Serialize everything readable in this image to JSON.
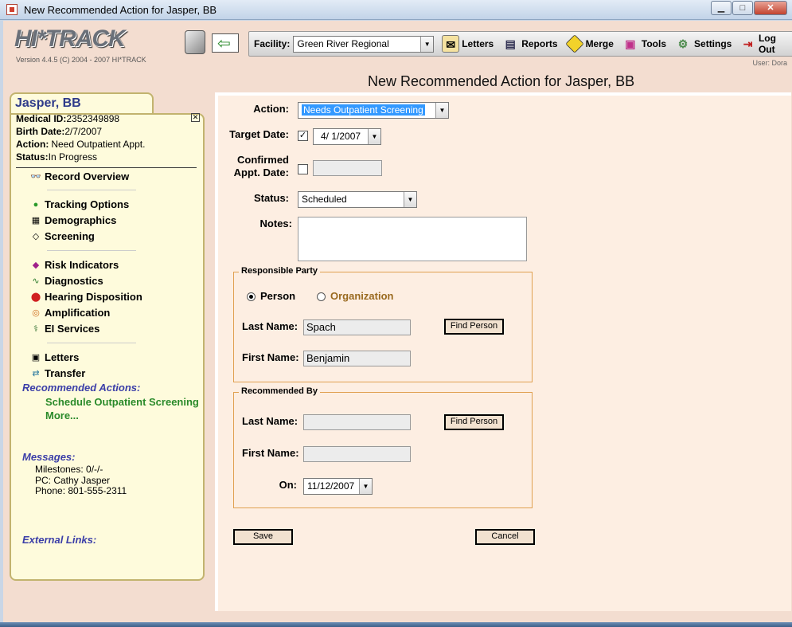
{
  "window": {
    "title": "New Recommended Action for Jasper, BB"
  },
  "header": {
    "logo": "HI*TRACK",
    "version": "Version 4.4.5 (C) 2004 - 2007 HI*TRACK",
    "facility_label": "Facility:",
    "facility_value": "Green River Regional",
    "toolbar": [
      "Letters",
      "Reports",
      "Merge",
      "Tools",
      "Settings",
      "Log Out"
    ],
    "user": "User: Dora",
    "page_heading": "New Recommended Action for Jasper, BB"
  },
  "patient": {
    "name": "Jasper, BB",
    "medical_id_label": "Medical ID:",
    "medical_id": "2352349898",
    "birth_label": "Birth Date:",
    "birth_date": "2/7/2007",
    "action_label": "Action:",
    "action": "Need Outpatient Appt.",
    "status_label": "Status:",
    "status": "In Progress"
  },
  "nav": {
    "record_overview": "Record Overview",
    "tracking_options": "Tracking Options",
    "demographics": "Demographics",
    "screening": "Screening",
    "risk_indicators": "Risk Indicators",
    "diagnostics": "Diagnostics",
    "hearing_disposition": "Hearing Disposition",
    "amplification": "Amplification",
    "ei_services": "EI Services",
    "letters": "Letters",
    "transfer": "Transfer"
  },
  "recommended": {
    "heading": "Recommended Actions:",
    "link": "Schedule Outpatient Screening",
    "more": "More..."
  },
  "messages": {
    "heading": "Messages:",
    "milestones": "Milestones: 0/-/-",
    "pc": "PC: Cathy Jasper",
    "phone": "Phone: 801-555-2311"
  },
  "external_links": "External Links:",
  "form": {
    "action_label": "Action:",
    "action_value": "Needs Outpatient Screening",
    "target_date_label": "Target Date:",
    "target_date_checked": true,
    "target_date_value": "4/  1/2007",
    "confirmed_label_1": "Confirmed",
    "confirmed_label_2": "Appt. Date:",
    "confirmed_checked": false,
    "confirmed_value": "",
    "status_label": "Status:",
    "status_value": "Scheduled",
    "notes_label": "Notes:",
    "notes_value": "",
    "responsible": {
      "title": "Responsible Party",
      "person": "Person",
      "organization": "Organization",
      "last_name_label": "Last Name:",
      "last_name": "Spach",
      "first_name_label": "First Name:",
      "first_name": "Benjamin",
      "find": "Find Person"
    },
    "recommended_by": {
      "title": "Recommended By",
      "last_name_label": "Last Name:",
      "last_name": "",
      "first_name_label": "First Name:",
      "first_name": "",
      "on_label": "On:",
      "on_value": "11/12/2007",
      "find": "Find Person"
    },
    "save": "Save",
    "cancel": "Cancel"
  }
}
